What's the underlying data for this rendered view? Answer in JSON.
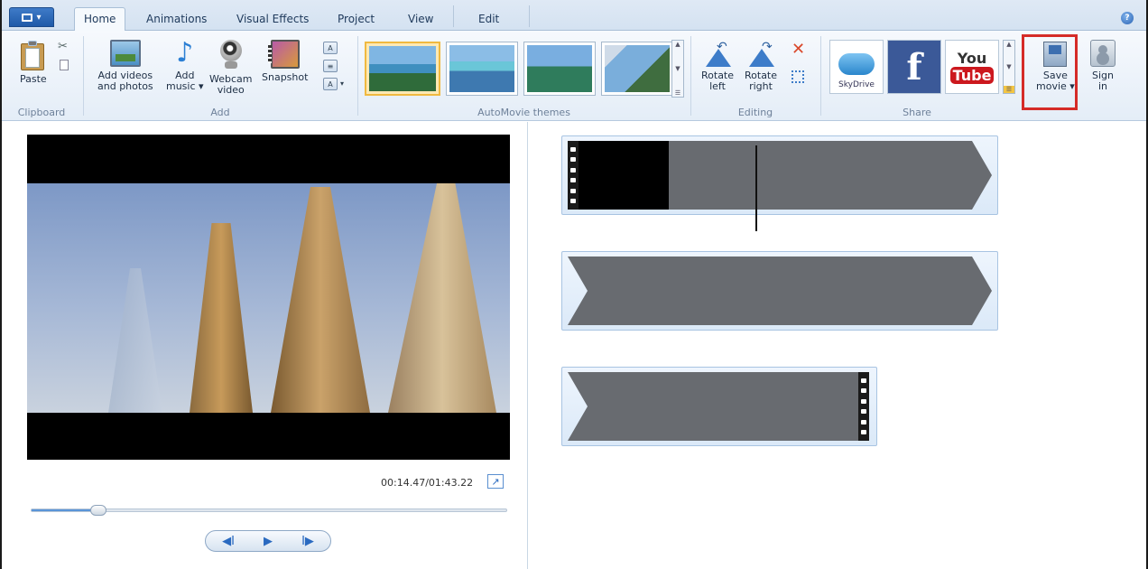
{
  "tabs": [
    "Home",
    "Animations",
    "Visual Effects",
    "Project",
    "View",
    "Edit"
  ],
  "ribbon": {
    "clipboard": {
      "paste": "Paste",
      "group": "Clipboard"
    },
    "add": {
      "add_videos": "Add videos\nand photos",
      "add_music": "Add\nmusic ▾",
      "webcam": "Webcam\nvideo",
      "snapshot": "Snapshot",
      "group": "Add"
    },
    "themes": {
      "group": "AutoMovie themes"
    },
    "editing": {
      "rotate_left": "Rotate\nleft",
      "rotate_right": "Rotate\nright",
      "group": "Editing"
    },
    "share": {
      "skydrive": "SkyDrive",
      "facebook": "f",
      "youtube_you": "You",
      "youtube_tube": "Tube",
      "save_movie": "Save\nmovie ▾",
      "sign_in": "Sign\nin",
      "group": "Share"
    }
  },
  "preview": {
    "time": "00:14.47/01:43.22",
    "seek_fraction": 0.14
  },
  "icons": {
    "help": "?",
    "popout": "↗",
    "prev_frame": "◀Ⅰ",
    "play": "▶",
    "next_frame": "Ⅰ▶"
  }
}
